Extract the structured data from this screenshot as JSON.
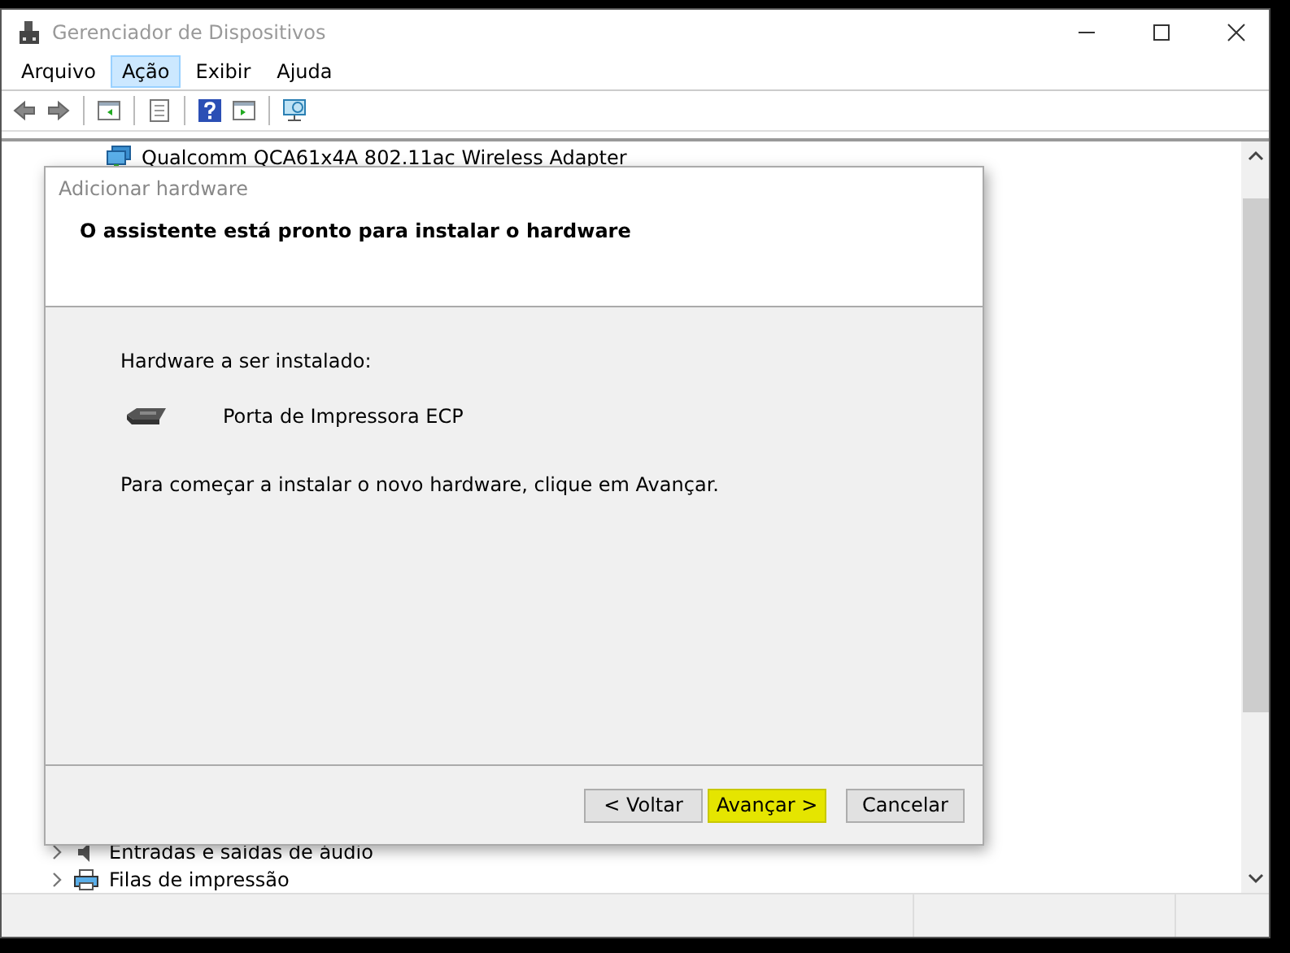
{
  "window": {
    "title": "Gerenciador de Dispositivos"
  },
  "menu": [
    {
      "label": "Arquivo",
      "selected": false
    },
    {
      "label": "Ação",
      "selected": true
    },
    {
      "label": "Exibir",
      "selected": false
    },
    {
      "label": "Ajuda",
      "selected": false
    }
  ],
  "toolbar": [
    {
      "kind": "back"
    },
    {
      "kind": "forward"
    },
    {
      "kind": "sep"
    },
    {
      "kind": "tree"
    },
    {
      "kind": "sep"
    },
    {
      "kind": "properties"
    },
    {
      "kind": "sep"
    },
    {
      "kind": "help"
    },
    {
      "kind": "run"
    },
    {
      "kind": "sep"
    },
    {
      "kind": "monitor"
    }
  ],
  "tree": {
    "top": [
      {
        "label": "Qualcomm QCA61x4A 802.11ac Wireless Adapter",
        "kind": "network"
      }
    ],
    "bottom": [
      {
        "label": "Entradas e saídas de áudio",
        "kind": "audio",
        "expandable": true
      },
      {
        "label": "Filas de impressão",
        "kind": "printer",
        "expandable": true
      }
    ]
  },
  "dialog": {
    "title": "Adicionar hardware",
    "heading": "O assistente está pronto para instalar o hardware",
    "section_label": "Hardware a ser instalado:",
    "device": "Porta de Impressora ECP",
    "instruction": "Para começar a instalar o novo hardware, clique em Avançar.",
    "buttons": [
      {
        "label": "< Voltar",
        "highlighted": false
      },
      {
        "label": "Avançar >",
        "highlighted": true
      },
      {
        "label": "Cancelar",
        "highlighted": false
      }
    ]
  }
}
